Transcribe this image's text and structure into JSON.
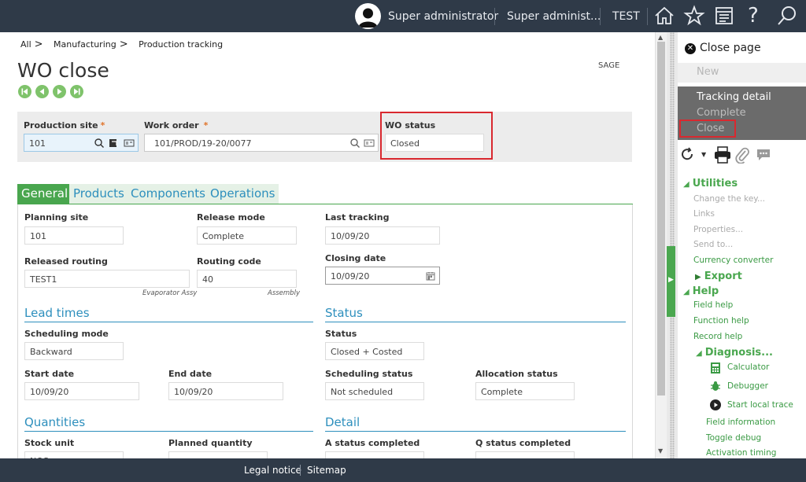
{
  "topbar": {
    "user": "Super administrator",
    "role": "Super administ...",
    "folder": "TEST",
    "icons": [
      "user-avatar-icon",
      "home-icon",
      "star-icon",
      "document-icon",
      "help-icon",
      "search-icon"
    ],
    "help_glyph": "?"
  },
  "breadcrumb": {
    "item1": "All",
    "item2": "Manufacturing",
    "item3": "Production tracking",
    "sep": ">"
  },
  "page": {
    "title": "WO close",
    "brand": "SAGE"
  },
  "header": {
    "production_site": {
      "label": "Production site",
      "value": "101"
    },
    "work_order": {
      "label": "Work order",
      "value": "101/PROD/19-20/0077"
    },
    "wo_status": {
      "label": "WO status",
      "value": "Closed"
    },
    "required_mark": "*"
  },
  "tabs": [
    "General",
    "Products",
    "Components",
    "Operations"
  ],
  "general": {
    "planning_site": {
      "label": "Planning site",
      "value": "101"
    },
    "release_mode": {
      "label": "Release mode",
      "value": "Complete"
    },
    "last_tracking": {
      "label": "Last tracking",
      "value": "10/09/20"
    },
    "released_routing": {
      "label": "Released routing",
      "value": "TEST1",
      "desc": "Evaporator Assy"
    },
    "routing_code": {
      "label": "Routing code",
      "value": "40",
      "desc": "Assembly"
    },
    "closing_date": {
      "label": "Closing date",
      "value": "10/09/20"
    },
    "lead_times_title": "Lead times",
    "status_title": "Status",
    "scheduling_mode": {
      "label": "Scheduling mode",
      "value": "Backward"
    },
    "status": {
      "label": "Status",
      "value": "Closed + Costed"
    },
    "start_date": {
      "label": "Start date",
      "value": "10/09/20"
    },
    "end_date": {
      "label": "End date",
      "value": "10/09/20"
    },
    "scheduling_status": {
      "label": "Scheduling status",
      "value": "Not scheduled"
    },
    "allocation_status": {
      "label": "Allocation status",
      "value": "Complete"
    },
    "quantities_title": "Quantities",
    "detail_title": "Detail",
    "stock_unit": {
      "label": "Stock unit",
      "value": "NOS"
    },
    "planned_quantity": {
      "label": "Planned quantity",
      "value": ""
    },
    "a_status_completed": {
      "label": "A status completed",
      "value": ""
    },
    "q_status_completed": {
      "label": "Q status completed",
      "value": ""
    }
  },
  "right_panel": {
    "close_page": "Close page",
    "new": "New",
    "tracking_detail": "Tracking detail",
    "complete": "Complete",
    "close": "Close",
    "utilities": "Utilities",
    "utilities_items": [
      "Change the key...",
      "Links",
      "Properties...",
      "Send to..."
    ],
    "currency_converter": "Currency converter",
    "export": "Export",
    "help": "Help",
    "help_items": [
      "Field help",
      "Function help",
      "Record help"
    ],
    "diagnosis": "Diagnosis...",
    "calculator": "Calculator",
    "debugger": "Debugger",
    "start_local_trace": "Start local trace",
    "field_information": "Field information",
    "toggle_debug": "Toggle debug",
    "activation_timing": "Activation timing"
  },
  "footer": {
    "legal": "Legal notice",
    "sitemap": "Sitemap"
  },
  "colors": {
    "accent_green": "#4aa74f",
    "link_blue": "#2d8fbd",
    "highlight_red": "#d9282f",
    "topbar": "#2f3a48"
  }
}
